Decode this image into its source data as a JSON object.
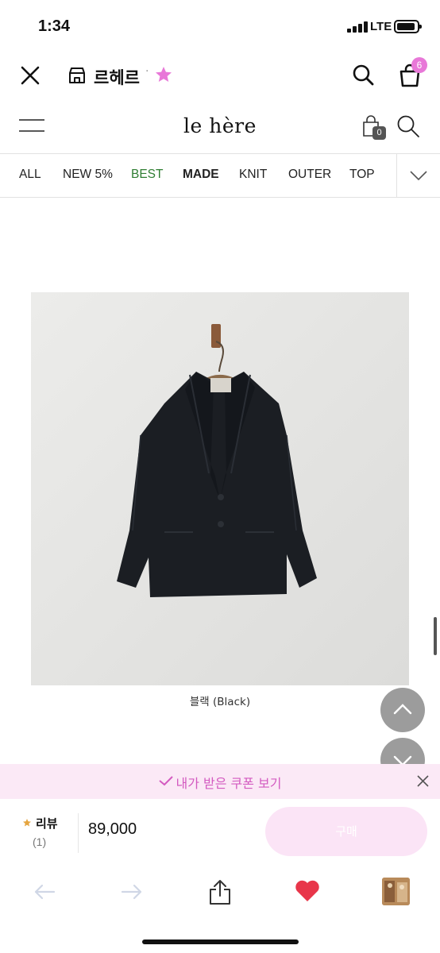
{
  "status_bar": {
    "time": "1:34",
    "network": "LTE"
  },
  "app_header": {
    "store_name": "르헤르",
    "separator": "·",
    "cart_count": "6"
  },
  "shop_header": {
    "logo": "le hère",
    "bag_count": "0"
  },
  "categories": [
    "ALL",
    "NEW 5%",
    "BEST",
    "MADE",
    "KNIT",
    "OUTER",
    "TOP"
  ],
  "product": {
    "caption": "블랙 (Black)"
  },
  "coupon_bar": {
    "text": "내가 받은 쿠폰 보기"
  },
  "purchase_bar": {
    "review_label": "리뷰",
    "review_count": "(1)",
    "price": "89,000",
    "buy_label": "구매"
  },
  "colors": {
    "accent_pink": "#e878d8",
    "coupon_bg": "#fbe9f6",
    "best_green": "#2e7d32",
    "heart_red": "#e8364a"
  },
  "icons": [
    "close-icon",
    "store-icon",
    "star-icon",
    "search-icon",
    "shopping-bag-icon",
    "menu-icon",
    "chevron-down-icon",
    "chevron-up-icon",
    "check-icon",
    "back-arrow-icon",
    "forward-arrow-icon",
    "share-icon",
    "heart-icon"
  ]
}
